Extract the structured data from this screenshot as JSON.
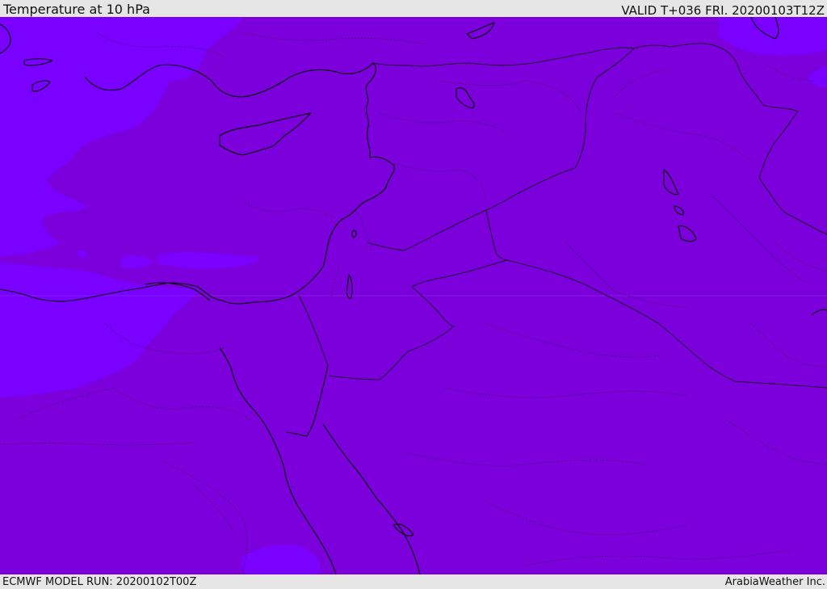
{
  "header": {
    "title": "Temperature at 10 hPa",
    "valid": "VALID T+036 FRI. 20200103T12Z"
  },
  "footer": {
    "model_run": "ECMWF MODEL RUN: 20200102T00Z",
    "credit": "ArabiaWeather Inc."
  },
  "colors": {
    "field_main": "#7b00dc",
    "field_warm_patch": "#7a00ff",
    "coastline": "#000000",
    "border": "#000000",
    "chrome_background": "#e6e6e6"
  }
}
